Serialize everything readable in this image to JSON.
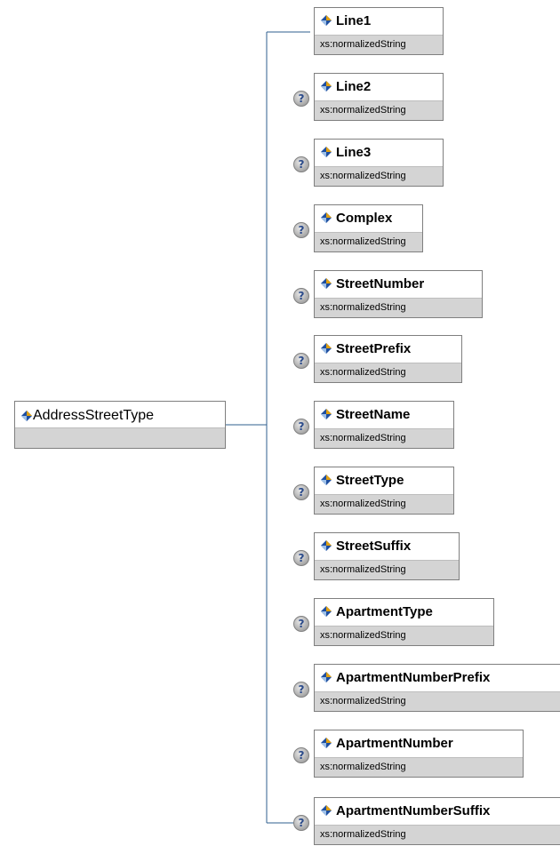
{
  "root": {
    "name": "AddressStreetType",
    "icon": "element-diamond-icon"
  },
  "children": [
    {
      "name": "Line1",
      "type": "xs:normalizedString",
      "optional": false
    },
    {
      "name": "Line2",
      "type": "xs:normalizedString",
      "optional": true
    },
    {
      "name": "Line3",
      "type": "xs:normalizedString",
      "optional": true
    },
    {
      "name": "Complex",
      "type": "xs:normalizedString",
      "optional": true
    },
    {
      "name": "StreetNumber",
      "type": "xs:normalizedString",
      "optional": true
    },
    {
      "name": "StreetPrefix",
      "type": "xs:normalizedString",
      "optional": true
    },
    {
      "name": "StreetName",
      "type": "xs:normalizedString",
      "optional": true
    },
    {
      "name": "StreetType",
      "type": "xs:normalizedString",
      "optional": true
    },
    {
      "name": "StreetSuffix",
      "type": "xs:normalizedString",
      "optional": true
    },
    {
      "name": "ApartmentType",
      "type": "xs:normalizedString",
      "optional": true
    },
    {
      "name": "ApartmentNumberPrefix",
      "type": "xs:normalizedString",
      "optional": true
    },
    {
      "name": "ApartmentNumber",
      "type": "xs:normalizedString",
      "optional": true
    },
    {
      "name": "ApartmentNumberSuffix",
      "type": "xs:normalizedString",
      "optional": true
    }
  ],
  "optional_marker": "?",
  "colors": {
    "connector": "#2f5f8f",
    "icon_blue": "#1f4f9f",
    "icon_gold": "#e0a010",
    "type_bg": "#d4d4d4"
  }
}
